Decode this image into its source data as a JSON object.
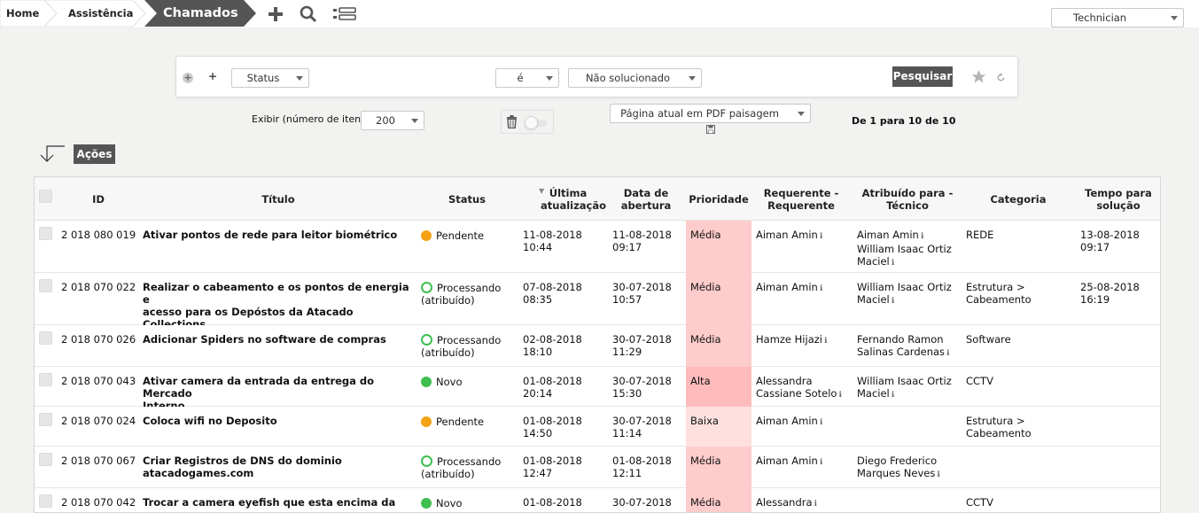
{
  "breadcrumb": {
    "home": "Home",
    "assistencia": "Assistência",
    "chamados": "Chamados"
  },
  "profile": {
    "selected": "Technician"
  },
  "search": {
    "field": "Status",
    "operator": "é",
    "value": "Não solucionado",
    "button": "Pesquisar"
  },
  "display": {
    "label": "Exibir (número de itens)",
    "count": "200",
    "export": "Página atual em PDF paisagem",
    "pagination": "De 1 para 10 de 10"
  },
  "actions": {
    "label": "Ações"
  },
  "colors": {
    "dark": "#555555",
    "prio_media": "#ffcccc",
    "prio_alta": "#ffbbbb",
    "prio_baixa": "#ffe0e0",
    "pendente": "#f5a214",
    "novo": "#3fbf4f",
    "processando": "#3fbf4f"
  },
  "table": {
    "headers": {
      "id": "ID",
      "titulo": "Título",
      "status": "Status",
      "ultima": "Última atualização",
      "abertura": "Data de abertura",
      "prioridade": "Prioridade",
      "requerente": "Requerente - Requerente",
      "atribuido": "Atribuído para - Técnico",
      "categoria": "Categoria",
      "tempo": "Tempo para solução"
    },
    "rows": [
      {
        "id": "2 018 080 019",
        "title": [
          "Ativar pontos de rede para leitor biométrico"
        ],
        "status": [
          "Pendente"
        ],
        "updated": [
          "11-08-2018",
          "10:44"
        ],
        "opened": [
          "11-08-2018",
          "09:17"
        ],
        "priority": "Média",
        "requester": [
          "Aiman Amin"
        ],
        "assigned": [
          "Aiman Amin",
          "William Isaac Ortiz",
          "Maciel"
        ],
        "category": [
          "REDE"
        ],
        "solution": [
          "13-08-2018",
          "09:17"
        ]
      },
      {
        "id": "2 018 070 022",
        "title": [
          "Realizar o cabeamento e os pontos de energia e",
          "acesso para os Depóstos da Atacado",
          "Collections"
        ],
        "status": [
          "Processando",
          "(atribuído)"
        ],
        "updated": [
          "07-08-2018",
          "08:35"
        ],
        "opened": [
          "30-07-2018",
          "10:57"
        ],
        "priority": "Média",
        "requester": [
          "Aiman Amin"
        ],
        "assigned": [
          "William Isaac Ortiz",
          "Maciel"
        ],
        "category": [
          "Estrutura >",
          "Cabeamento"
        ],
        "solution": [
          "25-08-2018",
          "16:19"
        ]
      },
      {
        "id": "2 018 070 026",
        "title": [
          "Adicionar Spiders no software de compras"
        ],
        "status": [
          "Processando",
          "(atribuído)"
        ],
        "updated": [
          "02-08-2018",
          "18:10"
        ],
        "opened": [
          "30-07-2018",
          "11:29"
        ],
        "priority": "Média",
        "requester": [
          "Hamze Hijazi"
        ],
        "assigned": [
          "Fernando Ramon",
          "Salinas Cardenas"
        ],
        "category": [
          "Software"
        ],
        "solution": []
      },
      {
        "id": "2 018 070 043",
        "title": [
          "Ativar camera da entrada da entrega do Mercado",
          "Interno."
        ],
        "status": [
          "Novo"
        ],
        "updated": [
          "01-08-2018",
          "20:14"
        ],
        "opened": [
          "30-07-2018",
          "15:30"
        ],
        "priority": "Alta",
        "requester": [
          "Alessandra",
          "Cassiane Sotelo"
        ],
        "assigned": [
          "William Isaac Ortiz",
          "Maciel"
        ],
        "category": [
          "CCTV"
        ],
        "solution": []
      },
      {
        "id": "2 018 070 024",
        "title": [
          "Coloca wifi no Deposito"
        ],
        "status": [
          "Pendente"
        ],
        "updated": [
          "01-08-2018",
          "14:50"
        ],
        "opened": [
          "30-07-2018",
          "11:14"
        ],
        "priority": "Baixa",
        "requester": [
          "Aiman Amin"
        ],
        "assigned": [],
        "category": [
          "Estrutura >",
          "Cabeamento"
        ],
        "solution": []
      },
      {
        "id": "2 018 070 067",
        "title": [
          "Criar Registros de DNS do dominio",
          "atacadogames.com"
        ],
        "status": [
          "Processando",
          "(atribuído)"
        ],
        "updated": [
          "01-08-2018",
          "12:47"
        ],
        "opened": [
          "01-08-2018",
          "12:11"
        ],
        "priority": "Média",
        "requester": [
          "Aiman Amin"
        ],
        "assigned": [
          "Diego Frederico",
          "Marques Neves"
        ],
        "category": [],
        "solution": []
      },
      {
        "id": "2 018 070 042",
        "title": [
          "Trocar a camera eyefish que esta encima da"
        ],
        "status": [
          "Novo"
        ],
        "updated": [
          "01-08-2018"
        ],
        "opened": [
          "30-07-2018"
        ],
        "priority": "Média",
        "requester": [
          "Alessandra"
        ],
        "assigned": [],
        "category": [
          "CCTV"
        ],
        "solution": []
      }
    ]
  }
}
